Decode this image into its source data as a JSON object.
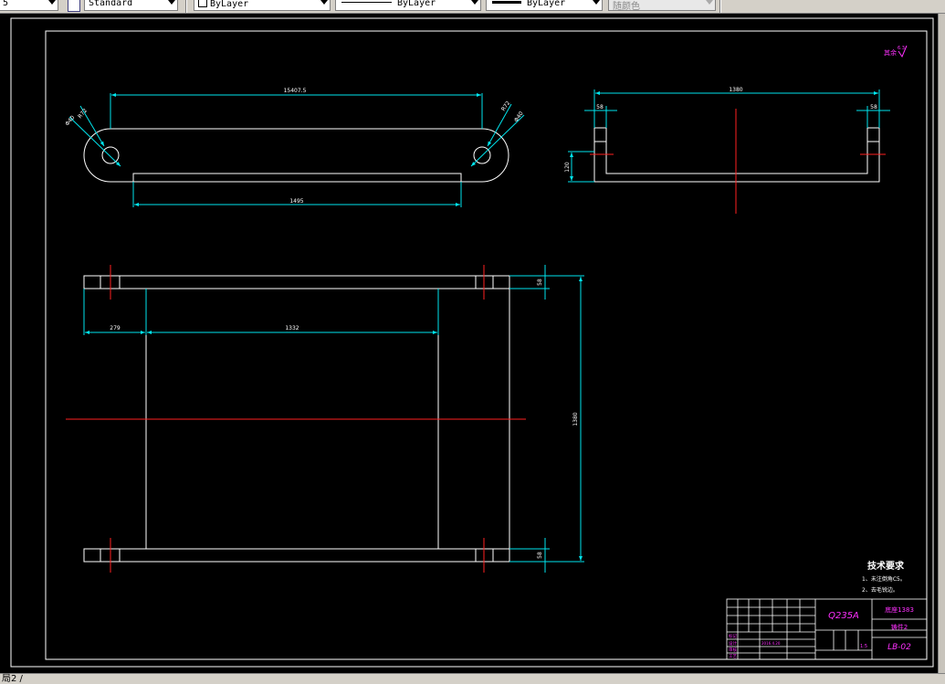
{
  "toolbar": {
    "left_stub": "5",
    "text_style": "Standard",
    "layer_color": "ByLayer",
    "linetype": "ByLayer",
    "lineweight": "ByLayer",
    "plot_style": "随颜色"
  },
  "colors": {
    "background": "#000000",
    "outline": "#ffffff",
    "dimension": "#00e5ee",
    "centerline": "#ff2020",
    "annotation": "#ff30ff"
  },
  "drawing": {
    "roughness_note": "其余",
    "roughness_value": "6.3",
    "top_view": {
      "overall_dim": "15407.5",
      "inner_dim": "1495",
      "radius_left": "R72",
      "dia_left": "Φ40",
      "radius_right": "R72",
      "dia_right": "Φ40"
    },
    "side_view": {
      "overall_dim": "1380",
      "left_dim": "58",
      "right_dim": "58",
      "height_dim": "120"
    },
    "front_view": {
      "left_dim": "279",
      "mid_dim": "1332",
      "overall_height": "1380",
      "top_dim": "58",
      "bottom_dim": "58"
    },
    "tech_requirements": {
      "title": "技术要求",
      "items": [
        "1、未注倒角C5。",
        "2、去毛锐边。"
      ]
    },
    "title_block": {
      "material": "Q235A",
      "part_name_top": "底座1383",
      "part_name_bottom": "铸件2",
      "drawing_no": "LB-02",
      "scale": "1:5",
      "row_labels": [
        "标记",
        "设计",
        "审核",
        "工艺"
      ],
      "designer_date": "2016.4.20"
    }
  },
  "status": {
    "text": "局2 /"
  }
}
